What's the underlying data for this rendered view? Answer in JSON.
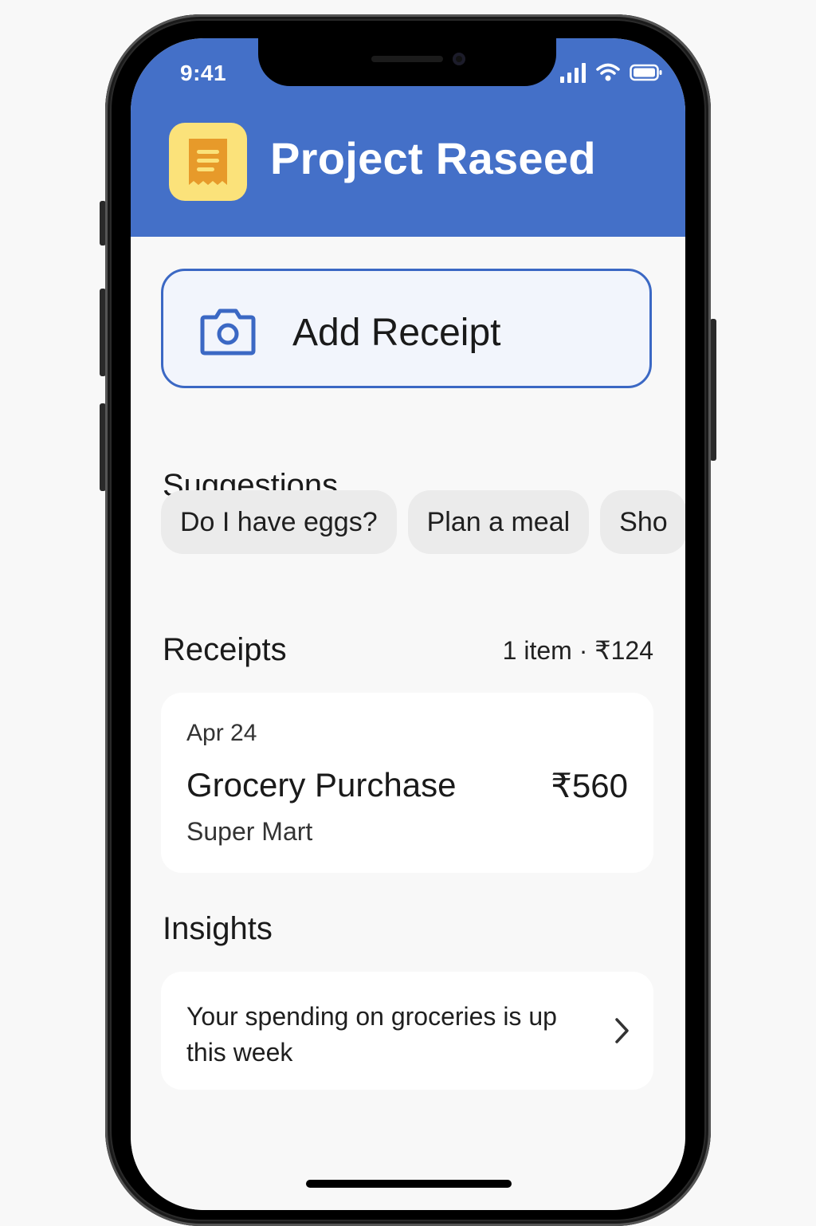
{
  "status_bar": {
    "time": "9:41"
  },
  "header": {
    "app_title": "Project Raseed",
    "brand_color": "#4470c8",
    "logo_icon": "receipt-icon"
  },
  "actions": {
    "add_receipt_label": "Add Receipt",
    "add_receipt_icon": "camera-icon"
  },
  "suggestions": {
    "title": "Suggestions",
    "chips": [
      "Do I have eggs?",
      "Plan a meal",
      "Sho"
    ]
  },
  "receipts": {
    "title": "Receipts",
    "summary": "1 item · ₹124",
    "items": [
      {
        "date": "Apr 24",
        "title": "Grocery Purchase",
        "amount": "₹560",
        "store": "Super Mart"
      }
    ]
  },
  "insights": {
    "title": "Insights",
    "items": [
      {
        "text": "Your spending on groceries is up this week",
        "icon": "chevron-right-icon"
      }
    ]
  }
}
